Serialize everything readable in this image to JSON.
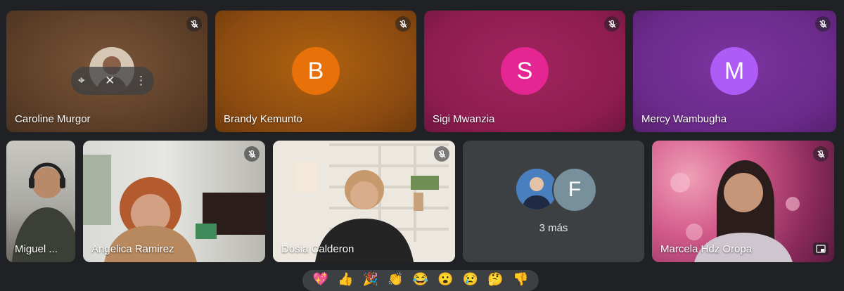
{
  "participants": {
    "caroline": {
      "name": "Caroline Murgor"
    },
    "brandy": {
      "name": "Brandy Kemunto",
      "initial": "B",
      "avatar_color": "#e8710a",
      "tile_color": "#8a4a10"
    },
    "sigi": {
      "name": "Sigi Mwanzia",
      "initial": "S",
      "avatar_color": "#e52592",
      "tile_color": "#8e1d4f"
    },
    "mercy": {
      "name": "Mercy Wambugha",
      "initial": "M",
      "avatar_color": "#af5cf7",
      "tile_color": "#6b2a8a"
    },
    "miguel": {
      "name": "Miguel ..."
    },
    "angelica": {
      "name": "Angelica Ramirez"
    },
    "dosia": {
      "name": "Dosia Calderon"
    },
    "marcela": {
      "name": "Marcela Hdz Oropa"
    }
  },
  "more_tile": {
    "initial": "F",
    "label": "3 más"
  },
  "reactions": [
    "💖",
    "👍",
    "🎉",
    "👏",
    "😂",
    "😮",
    "😢",
    "🤔",
    "👎"
  ],
  "icons": {
    "mute": "mic-off-icon",
    "pin": "pin-icon",
    "more": "more-vert-icon",
    "pip": "picture-in-picture-icon"
  }
}
